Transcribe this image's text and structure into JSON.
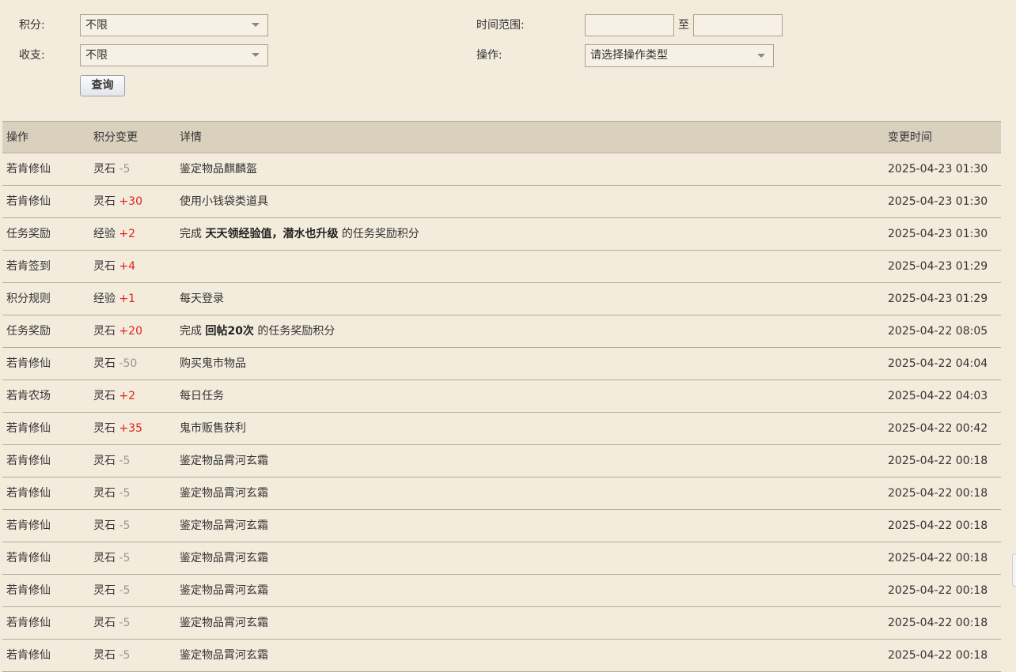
{
  "filters": {
    "points_label": "积分:",
    "points_value": "不限",
    "income_label": "收支:",
    "income_value": "不限",
    "time_label": "时间范围:",
    "time_sep": "至",
    "time_start": "",
    "time_end": "",
    "action_label": "操作:",
    "action_placeholder": "请选择操作类型",
    "query_button": "查询"
  },
  "table": {
    "headers": {
      "op": "操作",
      "change": "积分变更",
      "detail": "详情",
      "time": "变更时间"
    },
    "rows": [
      {
        "op": "若肯修仙",
        "currency": "灵石",
        "delta": "-5",
        "sign": "neg",
        "detail_prefix": "",
        "detail_bold": "",
        "detail_suffix": "鉴定物品麒麟盔",
        "time": "2025-04-23 01:30"
      },
      {
        "op": "若肯修仙",
        "currency": "灵石",
        "delta": "+30",
        "sign": "pos",
        "detail_prefix": "",
        "detail_bold": "",
        "detail_suffix": "使用小钱袋类道具",
        "time": "2025-04-23 01:30"
      },
      {
        "op": "任务奖励",
        "currency": "经验",
        "delta": "+2",
        "sign": "pos",
        "detail_prefix": "完成 ",
        "detail_bold": "天天领经验值，潜水也升级",
        "detail_suffix": " 的任务奖励积分",
        "time": "2025-04-23 01:30"
      },
      {
        "op": "若肯签到",
        "currency": "灵石",
        "delta": "+4",
        "sign": "pos",
        "detail_prefix": "",
        "detail_bold": "",
        "detail_suffix": "",
        "time": "2025-04-23 01:29"
      },
      {
        "op": "积分规则",
        "currency": "经验",
        "delta": "+1",
        "sign": "pos",
        "detail_prefix": "",
        "detail_bold": "",
        "detail_suffix": "每天登录",
        "time": "2025-04-23 01:29"
      },
      {
        "op": "任务奖励",
        "currency": "灵石",
        "delta": "+20",
        "sign": "pos",
        "detail_prefix": "完成 ",
        "detail_bold": "回帖20次",
        "detail_suffix": " 的任务奖励积分",
        "time": "2025-04-22 08:05"
      },
      {
        "op": "若肯修仙",
        "currency": "灵石",
        "delta": "-50",
        "sign": "neg",
        "detail_prefix": "",
        "detail_bold": "",
        "detail_suffix": "购买鬼市物品",
        "time": "2025-04-22 04:04"
      },
      {
        "op": "若肯农场",
        "currency": "灵石",
        "delta": "+2",
        "sign": "pos",
        "detail_prefix": "",
        "detail_bold": "",
        "detail_suffix": "每日任务",
        "time": "2025-04-22 04:03"
      },
      {
        "op": "若肯修仙",
        "currency": "灵石",
        "delta": "+35",
        "sign": "pos",
        "detail_prefix": "",
        "detail_bold": "",
        "detail_suffix": "鬼市贩售获利",
        "time": "2025-04-22 00:42"
      },
      {
        "op": "若肯修仙",
        "currency": "灵石",
        "delta": "-5",
        "sign": "neg",
        "detail_prefix": "",
        "detail_bold": "",
        "detail_suffix": "鉴定物品霄河玄霜",
        "time": "2025-04-22 00:18"
      },
      {
        "op": "若肯修仙",
        "currency": "灵石",
        "delta": "-5",
        "sign": "neg",
        "detail_prefix": "",
        "detail_bold": "",
        "detail_suffix": "鉴定物品霄河玄霜",
        "time": "2025-04-22 00:18"
      },
      {
        "op": "若肯修仙",
        "currency": "灵石",
        "delta": "-5",
        "sign": "neg",
        "detail_prefix": "",
        "detail_bold": "",
        "detail_suffix": "鉴定物品霄河玄霜",
        "time": "2025-04-22 00:18"
      },
      {
        "op": "若肯修仙",
        "currency": "灵石",
        "delta": "-5",
        "sign": "neg",
        "detail_prefix": "",
        "detail_bold": "",
        "detail_suffix": "鉴定物品霄河玄霜",
        "time": "2025-04-22 00:18"
      },
      {
        "op": "若肯修仙",
        "currency": "灵石",
        "delta": "-5",
        "sign": "neg",
        "detail_prefix": "",
        "detail_bold": "",
        "detail_suffix": "鉴定物品霄河玄霜",
        "time": "2025-04-22 00:18"
      },
      {
        "op": "若肯修仙",
        "currency": "灵石",
        "delta": "-5",
        "sign": "neg",
        "detail_prefix": "",
        "detail_bold": "",
        "detail_suffix": "鉴定物品霄河玄霜",
        "time": "2025-04-22 00:18"
      },
      {
        "op": "若肯修仙",
        "currency": "灵石",
        "delta": "-5",
        "sign": "neg",
        "detail_prefix": "",
        "detail_bold": "",
        "detail_suffix": "鉴定物品霄河玄霜",
        "time": "2025-04-22 00:18"
      }
    ]
  },
  "colors": {
    "positive": "#e0241b",
    "negative": "#999999",
    "header_bg": "#d9d0be",
    "page_bg": "#f3ebdc"
  }
}
